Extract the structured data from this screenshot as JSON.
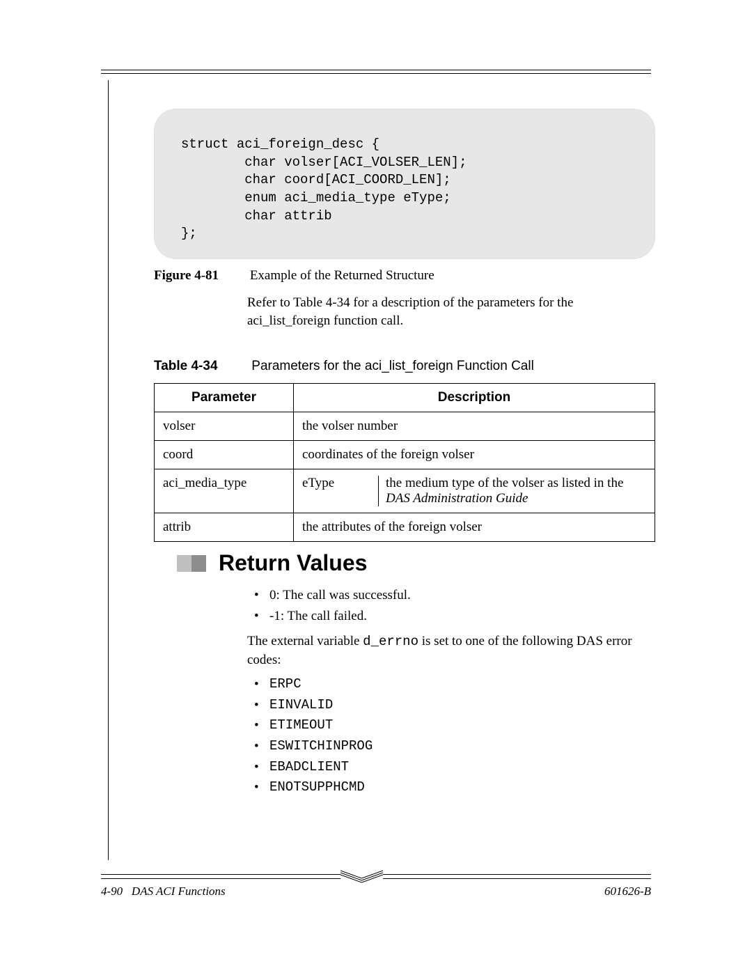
{
  "code_block": "struct aci_foreign_desc {\n        char volser[ACI_VOLSER_LEN];\n        char coord[ACI_COORD_LEN];\n        enum aci_media_type eType;\n        char attrib\n};",
  "figure": {
    "label": "Figure 4-81",
    "caption": "Example of the Returned Structure",
    "body": "Refer to Table 4-34 for a description of the parameters for the aci_list_foreign function call."
  },
  "table": {
    "label": "Table 4-34",
    "caption": "Parameters for the aci_list_foreign Function Call",
    "headers": {
      "param": "Parameter",
      "desc": "Description"
    },
    "rows": [
      {
        "param": "volser",
        "desc": "the volser number"
      },
      {
        "param": "coord",
        "desc": "coordinates of the foreign volser"
      },
      {
        "param": "aci_media_type",
        "sub1": "eType",
        "sub2a": "the medium type of the volser as listed in the ",
        "sub2b": "DAS Administration Guide"
      },
      {
        "param": "attrib",
        "desc": "the attributes of the foreign volser"
      }
    ]
  },
  "return_values": {
    "heading": "Return Values",
    "items": [
      "0: The call was successful.",
      "-1: The call failed."
    ],
    "para_pre": "The external variable ",
    "para_code": "d_errno",
    "para_post": " is set to one of the following DAS error codes:",
    "codes": [
      "ERPC",
      "EINVALID",
      "ETIMEOUT",
      "ESWITCHINPROG",
      "EBADCLIENT",
      "ENOTSUPPHCMD"
    ]
  },
  "footer": {
    "page": "4-90",
    "section": "DAS ACI Functions",
    "docnum": "601626-B"
  }
}
